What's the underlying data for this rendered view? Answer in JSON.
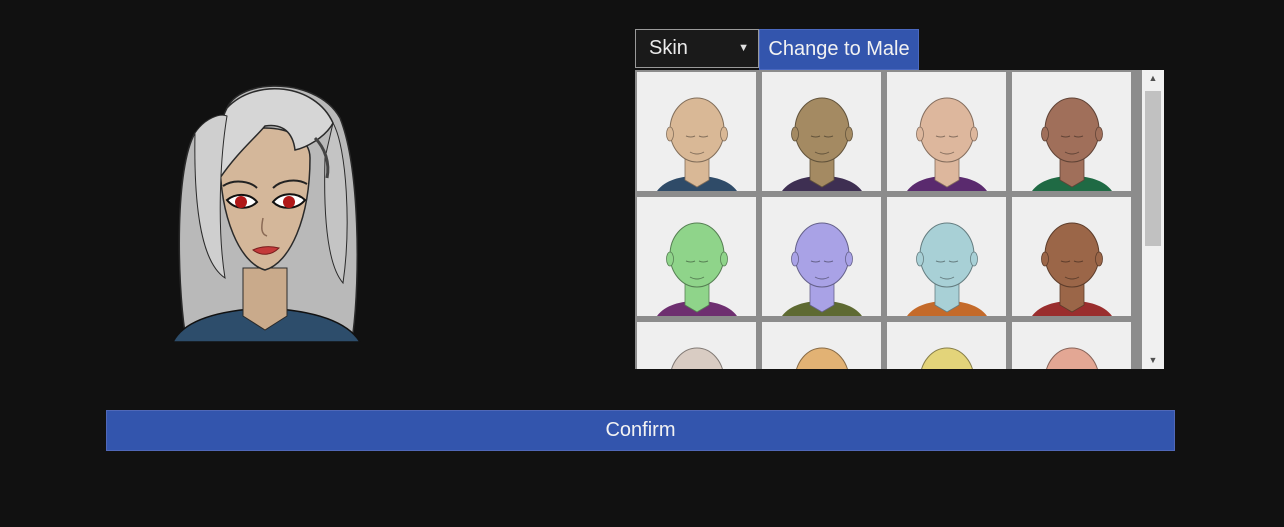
{
  "category_select": {
    "value": "Skin",
    "arrow_icon": "caret-down-icon"
  },
  "gender_button": {
    "label": "Change to Male"
  },
  "confirm_button": {
    "label": "Confirm"
  },
  "portrait": {
    "hair": "#c8c8c8",
    "skin": "#d4b79a",
    "eyes": "#b01818",
    "shirt": "#2d4d6b"
  },
  "skin_options": [
    {
      "skin": "#d9b896",
      "shirt": "#2f4b68"
    },
    {
      "skin": "#a48a62",
      "shirt": "#3e2f52"
    },
    {
      "skin": "#ddb79d",
      "shirt": "#5a2a6e"
    },
    {
      "skin": "#a06f5a",
      "shirt": "#1f6a44"
    },
    {
      "skin": "#8fd48a",
      "shirt": "#6e2f70"
    },
    {
      "skin": "#a9a2e6",
      "shirt": "#5e6a32"
    },
    {
      "skin": "#a8d0d6",
      "shirt": "#c46a2a"
    },
    {
      "skin": "#9b6648",
      "shirt": "#9a2e2e"
    },
    {
      "skin": "#d9ccc3",
      "shirt": "#555555"
    },
    {
      "skin": "#e2b274",
      "shirt": "#555555"
    },
    {
      "skin": "#e3d47a",
      "shirt": "#555555"
    },
    {
      "skin": "#e3a794",
      "shirt": "#555555"
    }
  ],
  "scrollbar": {
    "up_icon": "scroll-up-arrow-icon",
    "down_icon": "scroll-down-arrow-icon"
  }
}
